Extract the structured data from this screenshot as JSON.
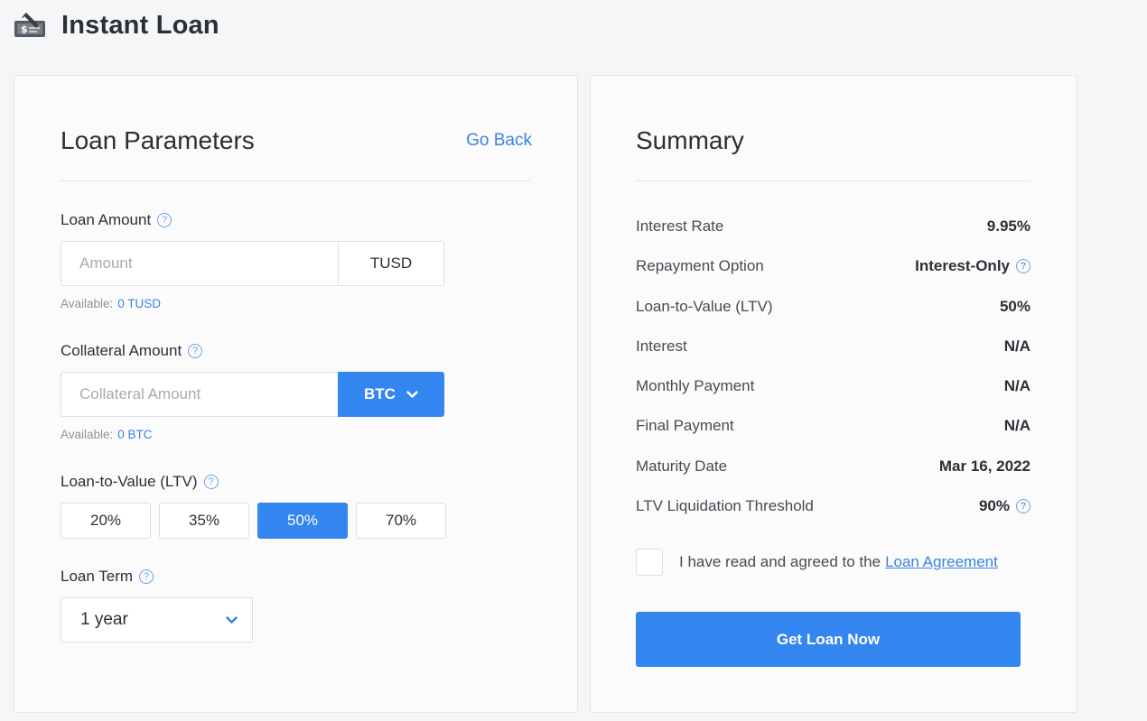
{
  "header": {
    "title": "Instant Loan",
    "icon": "loan-cheque-icon"
  },
  "params": {
    "title": "Loan Parameters",
    "go_back": "Go Back",
    "loan_amount": {
      "label": "Loan Amount",
      "placeholder": "Amount",
      "currency": "TUSD",
      "available_label": "Available:",
      "available_value": "0 TUSD"
    },
    "collateral": {
      "label": "Collateral Amount",
      "placeholder": "Collateral Amount",
      "currency": "BTC",
      "available_label": "Available:",
      "available_value": "0 BTC"
    },
    "ltv": {
      "label": "Loan-to-Value (LTV)",
      "options": [
        "20%",
        "35%",
        "50%",
        "70%"
      ],
      "selected": "50%"
    },
    "term": {
      "label": "Loan Term",
      "value": "1 year"
    }
  },
  "summary": {
    "title": "Summary",
    "rows": [
      {
        "key": "Interest Rate",
        "value": "9.95%"
      },
      {
        "key": "Repayment Option",
        "value": "Interest-Only"
      },
      {
        "key": "Loan-to-Value (LTV)",
        "value": "50%"
      },
      {
        "key": "Interest",
        "value": "N/A"
      },
      {
        "key": "Monthly Payment",
        "value": "N/A"
      },
      {
        "key": "Final Payment",
        "value": "N/A"
      },
      {
        "key": "Maturity Date",
        "value": "Mar 16, 2022"
      },
      {
        "key": "LTV Liquidation Threshold",
        "value": "90%"
      }
    ],
    "agree_text": "I have read and agreed to the",
    "agree_link": "Loan Agreement",
    "cta": "Get Loan Now"
  },
  "colors": {
    "accent": "#3385f0",
    "link": "#3b82e0"
  }
}
